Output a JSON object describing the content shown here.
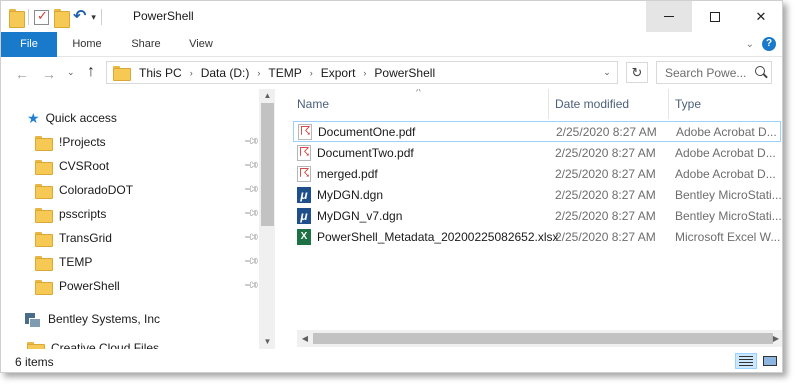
{
  "titlebar": {
    "title": "PowerShell",
    "qat_dropdown": "▾",
    "minimize": "",
    "maximize": "",
    "close": "✕"
  },
  "ribbon": {
    "tabs": [
      "File",
      "Home",
      "Share",
      "View"
    ],
    "expand": "⌄",
    "help": "?"
  },
  "nav": {
    "back": "←",
    "forward": "→",
    "recent": "⌄",
    "up": "↑",
    "breadcrumb": [
      "This PC",
      "Data (D:)",
      "TEMP",
      "Export",
      "PowerShell"
    ],
    "address_dropdown": "⌄",
    "refresh": "↻",
    "search_placeholder": "Search Powe..."
  },
  "sidebar": {
    "quick_access": "Quick access",
    "items": [
      {
        "label": "!Projects",
        "pinned": true
      },
      {
        "label": "CVSRoot",
        "pinned": true
      },
      {
        "label": "ColoradoDOT",
        "pinned": true
      },
      {
        "label": "psscripts",
        "pinned": true
      },
      {
        "label": "TransGrid",
        "pinned": true
      },
      {
        "label": "TEMP",
        "pinned": true
      },
      {
        "label": "PowerShell",
        "pinned": true
      }
    ],
    "bentley": "Bentley Systems, Inc",
    "creative_cloud": "Creative Cloud Files"
  },
  "content": {
    "columns": {
      "name": "Name",
      "date": "Date modified",
      "type": "Type"
    },
    "sort_indicator": "^",
    "files": [
      {
        "name": "DocumentOne.pdf",
        "date": "2/25/2020 8:27 AM",
        "type": "Adobe Acrobat D...",
        "icon": "pdf-icon",
        "selected": true
      },
      {
        "name": "DocumentTwo.pdf",
        "date": "2/25/2020 8:27 AM",
        "type": "Adobe Acrobat D...",
        "icon": "pdf-icon",
        "selected": false
      },
      {
        "name": "merged.pdf",
        "date": "2/25/2020 8:27 AM",
        "type": "Adobe Acrobat D...",
        "icon": "pdf-icon",
        "selected": false
      },
      {
        "name": "MyDGN.dgn",
        "date": "2/25/2020 8:27 AM",
        "type": "Bentley MicroStati...",
        "icon": "microstation-icon",
        "selected": false
      },
      {
        "name": "MyDGN_v7.dgn",
        "date": "2/25/2020 8:27 AM",
        "type": "Bentley MicroStati...",
        "icon": "microstation-icon",
        "selected": false
      },
      {
        "name": "PowerShell_Metadata_20200225082652.xlsx",
        "date": "2/25/2020 8:27 AM",
        "type": "Microsoft Excel W...",
        "icon": "excel-icon",
        "selected": false
      }
    ]
  },
  "status": {
    "item_count": "6 items"
  },
  "colors": {
    "accent": "#1979ca",
    "selection_border": "#99d1ff",
    "folder": "#f6c955"
  }
}
